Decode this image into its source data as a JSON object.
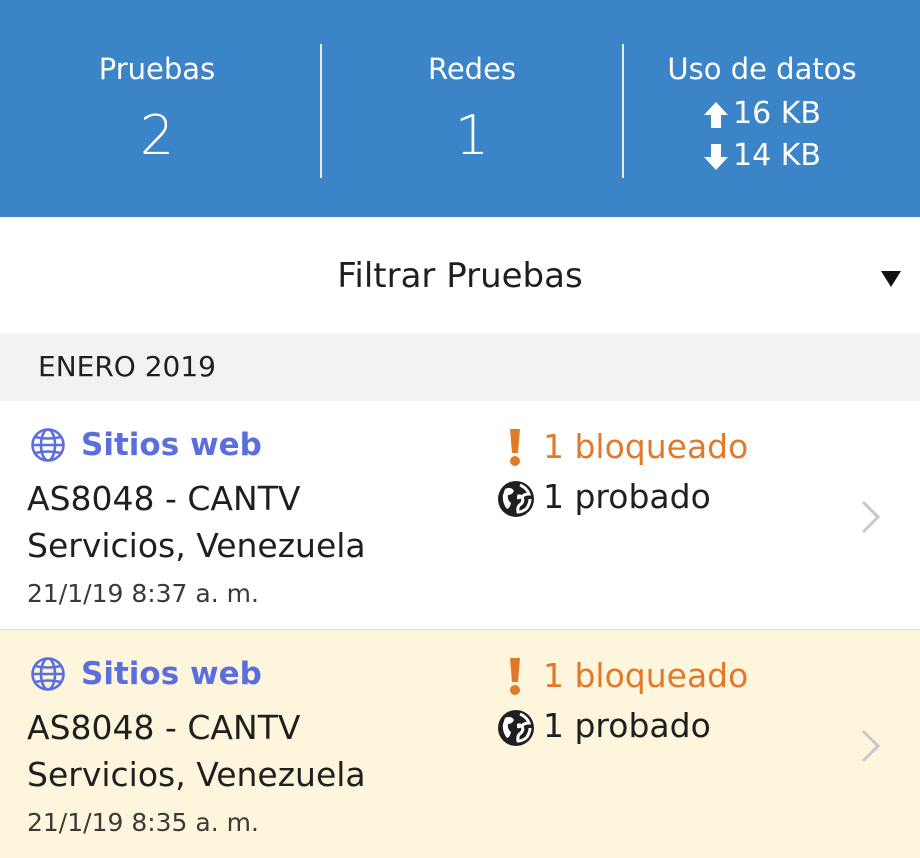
{
  "stats": {
    "tests": {
      "label": "Pruebas",
      "value": "2"
    },
    "networks": {
      "label": "Redes",
      "value": "1"
    },
    "data_usage": {
      "label": "Uso de datos",
      "upload": "16 KB",
      "download": "14 KB"
    }
  },
  "filter": {
    "label": "Filtrar Pruebas",
    "caret_icon": "caret-down-icon"
  },
  "month_header": "ENERO 2019",
  "results": [
    {
      "type": "Sitios web",
      "type_icon": "globe-outline-icon",
      "network": "AS8048 - CANTV Servicios, Venezuela",
      "timestamp": "21/1/19 8:37 a. m.",
      "blocked": "1 bloqueado",
      "tested": "1 probado",
      "highlighted": false
    },
    {
      "type": "Sitios web",
      "type_icon": "globe-outline-icon",
      "network": "AS8048 - CANTV Servicios, Venezuela",
      "timestamp": "21/1/19 8:35 a. m.",
      "blocked": "1 bloqueado",
      "tested": "1 probado",
      "highlighted": true
    }
  ],
  "colors": {
    "header_bg": "#3b84c8",
    "accent_blue": "#5b6fdc",
    "blocked_orange": "#e07a2a",
    "highlight_bg": "#fdf6dd",
    "month_header_bg": "#f1f2f3"
  }
}
